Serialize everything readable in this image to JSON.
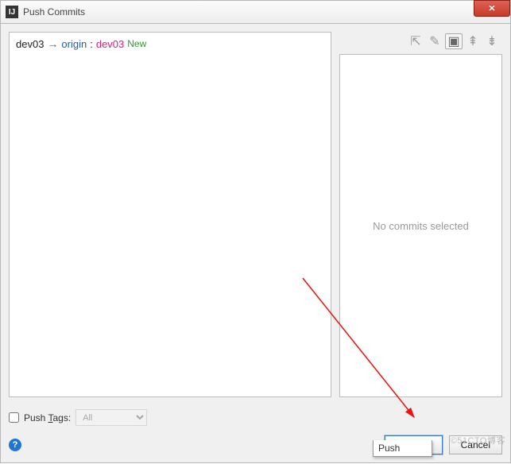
{
  "titlebar": {
    "title": "Push Commits",
    "app_icon_text": "IJ"
  },
  "branch": {
    "local": "dev03",
    "remote": "origin",
    "target": "dev03",
    "new_tag": "New"
  },
  "toolbar_icons": {
    "pin": "⇱",
    "edit": "✎",
    "group": "▣",
    "expand": "⇞",
    "collapse": "⇟"
  },
  "right_panel": {
    "empty_text": "No commits selected"
  },
  "push_tags": {
    "label_prefix": "Push ",
    "label_ul": "T",
    "label_suffix": "ags:",
    "selected": "All"
  },
  "buttons": {
    "push_ul": "P",
    "push_suffix": "ush",
    "cancel": "Cancel",
    "dropdown_item": "Push"
  },
  "help": {
    "symbol": "?"
  },
  "watermark": "©51CTO博客"
}
